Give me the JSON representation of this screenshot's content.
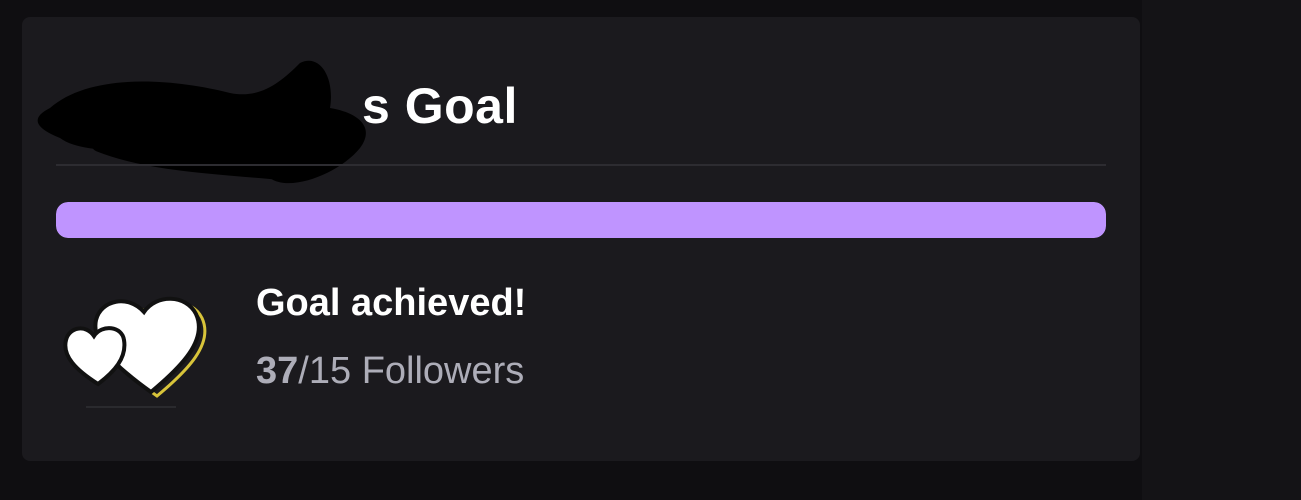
{
  "goal": {
    "title": "s Goal",
    "progress_fraction": 1.0,
    "status": "Goal achieved!",
    "current": "37",
    "separator": "/",
    "target": "15",
    "unit": "Followers",
    "icon": "hearts-icon"
  },
  "colors": {
    "accent": "#bf94ff",
    "card_background": "#1b1a1e",
    "page_background": "#0f0e11",
    "text_primary": "#ffffff",
    "text_secondary": "#adadb8"
  }
}
